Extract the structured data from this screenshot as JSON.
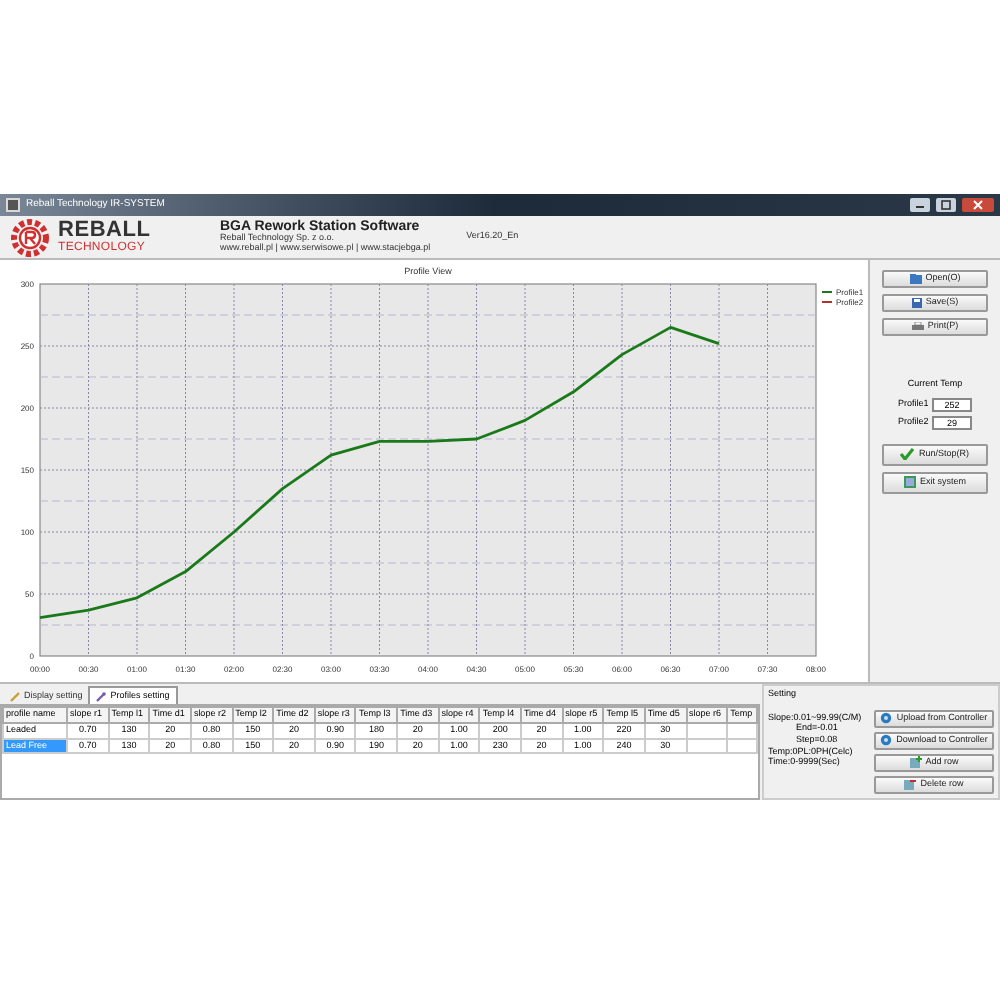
{
  "window": {
    "title": "Reball Technology IR-SYSTEM"
  },
  "header": {
    "logo_name": "REBALL",
    "logo_sub": "TECHNOLOGY",
    "title": "BGA Rework Station Software",
    "company": "Reball Technology Sp. z o.o.",
    "websites": "www.reball.pl | www.serwisowe.pl | www.stacjebga.pl",
    "version": "Ver16.20_En"
  },
  "chart": {
    "chart_data": {
      "type": "line",
      "title": "Profile View",
      "categories": [
        "00:00",
        "00:30",
        "01:00",
        "01:30",
        "02:00",
        "02:30",
        "03:00",
        "03:30",
        "04:00",
        "04:30",
        "05:00",
        "05:30",
        "06:00",
        "06:30",
        "07:00",
        "07:30",
        "08:00"
      ],
      "series": [
        {
          "name": "Profile1",
          "color": "#1a7a1a",
          "values": [
            31,
            37,
            47,
            68,
            100,
            135,
            162,
            173,
            173,
            175,
            190,
            213,
            243,
            265,
            252,
            null,
            null
          ]
        },
        {
          "name": "Profile2",
          "color": "#b03030",
          "values": [
            null,
            null,
            null,
            null,
            null,
            null,
            null,
            null,
            null,
            null,
            null,
            null,
            null,
            null,
            null,
            null,
            null
          ]
        }
      ],
      "grid": true,
      "ylim": [
        0,
        300
      ],
      "yticks": [
        0,
        50,
        100,
        150,
        200,
        250,
        300
      ]
    }
  },
  "side_buttons": [
    {
      "kind": "open",
      "label": "Open(O)"
    },
    {
      "kind": "save",
      "label": "Save(S)"
    },
    {
      "kind": "print",
      "label": "Print(P)"
    }
  ],
  "current_temp": {
    "label": "Current Temp",
    "fields": [
      {
        "label": "Profile1",
        "value": "252"
      },
      {
        "label": "Profile2",
        "value": "29"
      }
    ]
  },
  "action_buttons": [
    {
      "kind": "run",
      "label": "Run/Stop(R)"
    },
    {
      "kind": "exit",
      "label": "Exit system"
    }
  ],
  "tabs": [
    {
      "label": "Display setting",
      "selected": false
    },
    {
      "label": "Profiles setting",
      "selected": true
    }
  ],
  "table": {
    "columns": [
      "profile name",
      "slope r1",
      "Temp l1",
      "Time d1",
      "slope r2",
      "Temp l2",
      "Time d2",
      "slope r3",
      "Temp l3",
      "Time d3",
      "slope r4",
      "Temp l4",
      "Time d4",
      "slope r5",
      "Temp l5",
      "Time d5",
      "slope r6",
      "Temp"
    ],
    "rows": [
      {
        "selected": false,
        "cells": [
          "Leaded",
          "0.70",
          "130",
          "20",
          "0.80",
          "150",
          "20",
          "0.90",
          "180",
          "20",
          "1.00",
          "200",
          "20",
          "1.00",
          "220",
          "30"
        ]
      },
      {
        "selected": true,
        "cells": [
          "Lead Free",
          "0.70",
          "130",
          "20",
          "0.80",
          "150",
          "20",
          "0.90",
          "190",
          "20",
          "1.00",
          "230",
          "20",
          "1.00",
          "240",
          "30"
        ]
      }
    ]
  },
  "setting": {
    "title": "Setting",
    "lines": [
      "Slope:0.01~99.99(C/M)",
      "End=-0.01",
      "Step=0.08",
      "Temp:0PL:0PH(Celc)",
      "Time:0-9999(Sec)"
    ]
  },
  "controller_buttons": [
    {
      "kind": "upload",
      "label": "Upload from Controller"
    },
    {
      "kind": "download",
      "label": "Download to Controller"
    },
    {
      "kind": "add",
      "label": "Add row"
    },
    {
      "kind": "delete",
      "label": "Delete row"
    }
  ]
}
